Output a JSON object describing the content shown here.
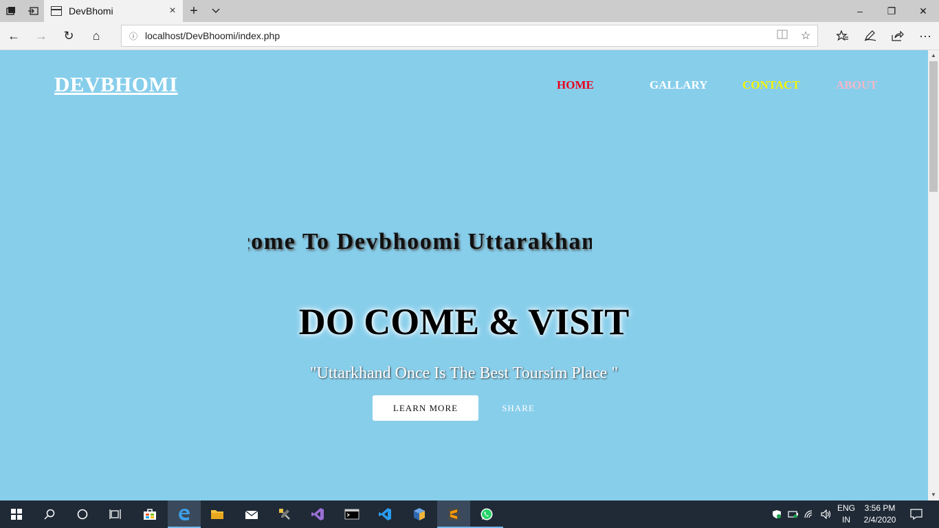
{
  "browser": {
    "tab_title": "DevBhomi",
    "url": "localhost/DevBhoomi/index.php",
    "icons": {
      "tab_manager": "tab-manager-icon",
      "set_aside": "set-aside-tabs-icon",
      "new_tab": "+",
      "tab_list": "chevron-down-icon",
      "close_tab": "×",
      "back": "←",
      "forward": "→",
      "refresh": "↻",
      "home": "⌂",
      "info": "ⓘ",
      "reading_view": "reading-view-icon",
      "favorite": "☆",
      "favorites_list": "favorites-icon",
      "pen": "pen-icon",
      "share": "share-icon",
      "more": "···",
      "minimize": "–",
      "restore": "❐",
      "close": "✕"
    }
  },
  "site": {
    "logo": "DEVBHOMI",
    "menu": [
      {
        "label": "HOME",
        "color": "#e8001c"
      },
      {
        "label": "GALLARY",
        "color": "#ffffff"
      },
      {
        "label": "CONTACT",
        "color": "#f4f400"
      },
      {
        "label": "ABOUT",
        "color": "#f5b8c8"
      }
    ],
    "marquee": "Welcome To Devbhoomi Uttarakhand",
    "hero_title": "DO COME & VISIT",
    "hero_subtitle": "\"Uttarkhand Once Is The Best Toursim Place \"",
    "learn_more": "LEARN MORE",
    "share": "SHARE",
    "background": "#87ceeb"
  },
  "taskbar": {
    "apps": [
      "start-icon",
      "search-icon",
      "cortana-icon",
      "task-view-icon",
      "store-icon",
      "edge-icon",
      "file-explorer-icon",
      "mail-icon",
      "tools-icon",
      "visual-studio-icon",
      "terminal-icon",
      "vscode-icon",
      "virtualbox-icon",
      "sublime-icon",
      "whatsapp-icon"
    ],
    "language_top": "ENG",
    "language_bottom": "IN",
    "time": "3:56 PM",
    "date": "2/4/2020"
  }
}
